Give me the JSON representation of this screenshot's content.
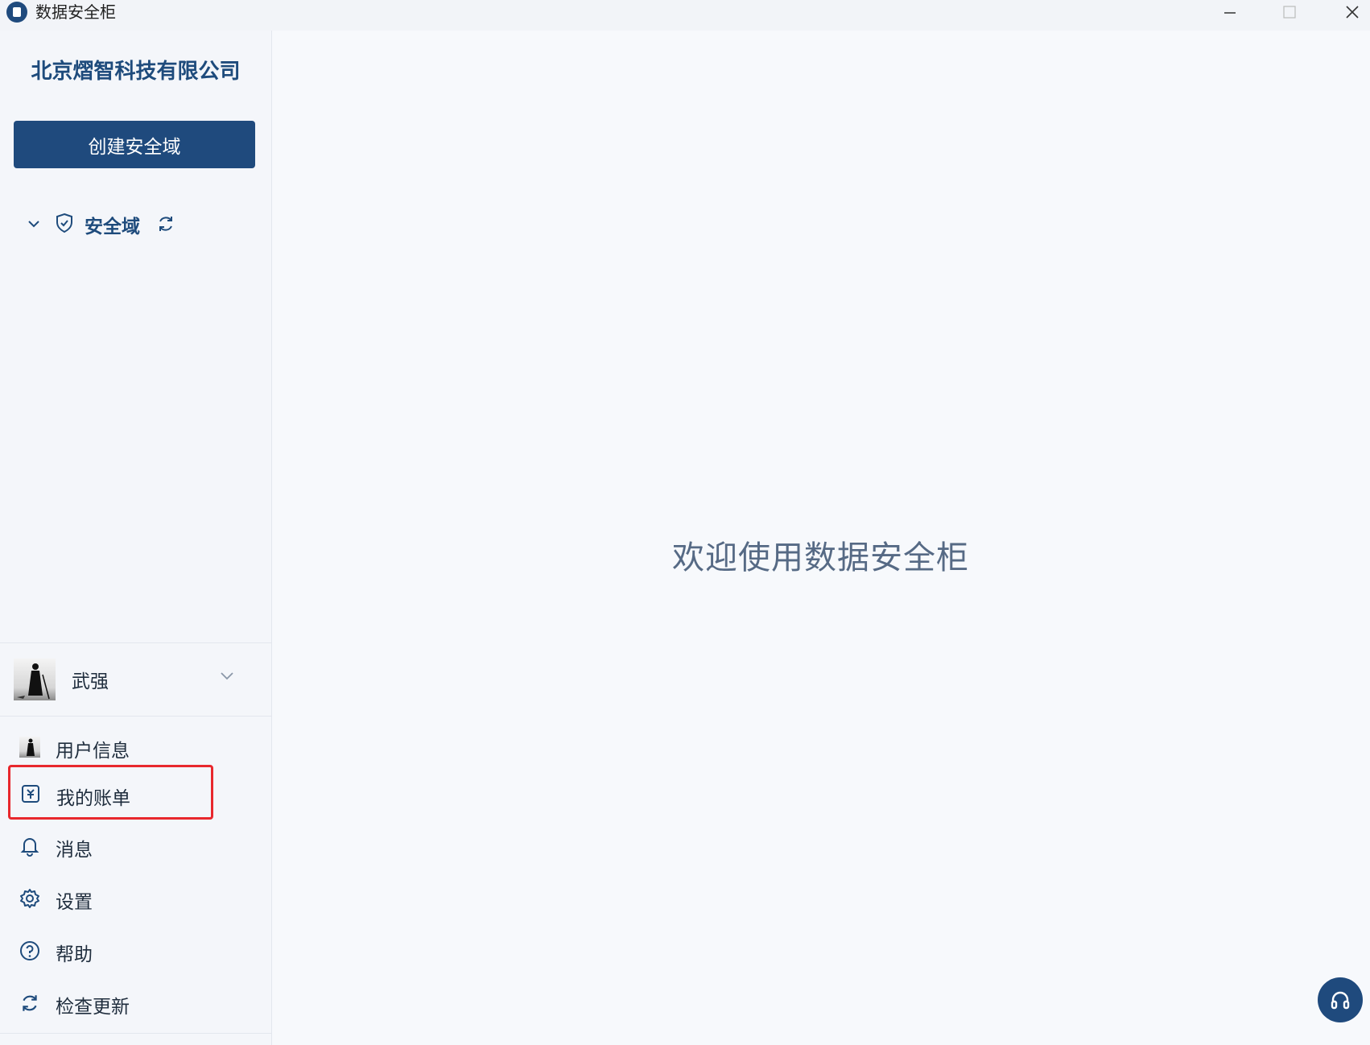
{
  "window": {
    "title": "数据安全柜"
  },
  "sidebar": {
    "company": "北京熠智科技有限公司",
    "create_button": "创建安全域",
    "domain_section": {
      "label": "安全域",
      "expanded": true
    },
    "user": {
      "name": "武强"
    },
    "menu": [
      {
        "label": "用户信息",
        "icon": "avatar-icon"
      },
      {
        "label": "我的账单",
        "icon": "bill-icon",
        "highlighted": true
      },
      {
        "label": "消息",
        "icon": "bell-icon"
      },
      {
        "label": "设置",
        "icon": "gear-icon"
      },
      {
        "label": "帮助",
        "icon": "help-icon"
      },
      {
        "label": "检查更新",
        "icon": "refresh-icon"
      }
    ]
  },
  "main": {
    "welcome": "欢迎使用数据安全柜"
  },
  "colors": {
    "primary": "#1f4a7d",
    "highlight": "#e8282d",
    "background": "#f7f9fc"
  }
}
